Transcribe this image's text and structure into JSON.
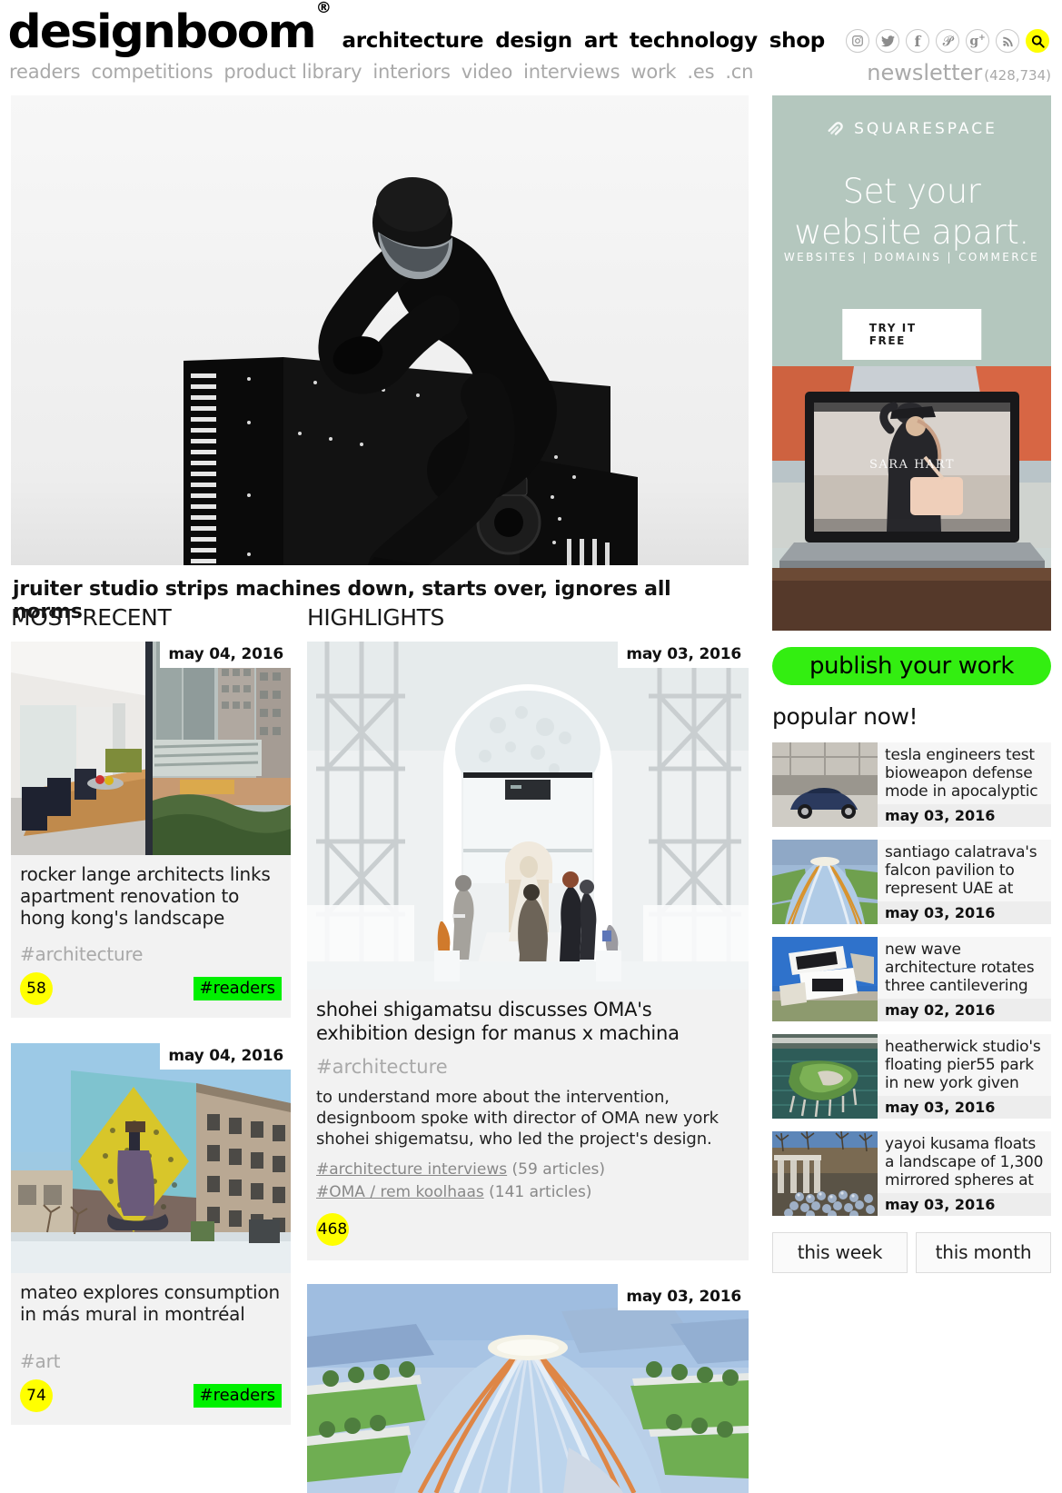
{
  "header": {
    "logo": "designboom",
    "logo_reg": "®",
    "primary_nav": [
      "architecture",
      "design",
      "art",
      "technology",
      "shop"
    ],
    "secondary_nav": [
      "readers",
      "competitions",
      "product library",
      "interiors",
      "video",
      "interviews",
      "work",
      ".es",
      ".cn"
    ],
    "social_icons": [
      "instagram-icon",
      "twitter-icon",
      "facebook-icon",
      "pinterest-icon",
      "googleplus-icon",
      "rss-icon",
      "search-icon"
    ],
    "newsletter_label": "newsletter",
    "newsletter_count": "(428,734)"
  },
  "hero": {
    "title": "jruiter studio strips machines down, starts over, ignores all norms",
    "image_alt": "rider in black suit and helmet on a matte black snowmobile"
  },
  "sections": {
    "most_recent": "MOST RECENT",
    "highlights": "HIGHLIGHTS"
  },
  "most_recent": [
    {
      "date": "may 04, 2016",
      "title": "rocker lange architects links apartment renovation to hong kong's landscape",
      "tag": "#architecture",
      "count": "58",
      "readers": "#readers",
      "image_alt": "white apartment interior with wooden table opening onto hong kong street view"
    },
    {
      "date": "may 04, 2016",
      "title": "mateo explores consumption in más mural in montréal",
      "tag": "#art",
      "count": "74",
      "readers": "#readers",
      "image_alt": "yellow diamond mural of seated figure on a brick building facade"
    }
  ],
  "highlights": [
    {
      "date": "may 03, 2016",
      "title": "shohei shigamatsu discusses OMA's exhibition design for manus x machina",
      "tag": "#architecture",
      "body": "to understand more about the intervention, designboom spoke with director of OMA new york shohei shigematsu, who led the project's design.",
      "links": [
        {
          "label": "#architecture interviews",
          "count": "(59 articles)"
        },
        {
          "label": "#OMA / rem koolhaas",
          "count": "(141 articles)"
        }
      ],
      "count": "468",
      "image_alt": "white arched exhibition hall with visitors viewing a gown on a plinth"
    },
    {
      "date": "may 03, 2016",
      "title": "",
      "image_alt": "blue fanned roof architectural rendering of a pavilion with landscaped plaza"
    }
  ],
  "ad": {
    "brand": "SQUARESPACE",
    "headline_line1": "Set your",
    "headline_line2": "website apart.",
    "subline": "WEBSITES  |  DOMAINS  |  COMMERCE",
    "cta": "TRY IT FREE",
    "photo_alt": "laptop on a wooden table showing a fashion website named SARA HART",
    "screen_brand": "SARA HART",
    "bg_color": "#b4c7be"
  },
  "publish_button": "publish your work",
  "popular": {
    "heading": "popular now!",
    "items": [
      {
        "title": "tesla engineers test bioweapon defense mode in apocalyptic",
        "date": "may 03, 2016",
        "image_alt": "dark blue tesla sedan inside an industrial factory"
      },
      {
        "title": "santiago calatrava's falcon pavilion to represent UAE at",
        "date": "may 03, 2016",
        "image_alt": "blue winged pavilion rendering surrounded by green lawns"
      },
      {
        "title": "new wave architecture rotates three cantilevering",
        "date": "may 02, 2016",
        "image_alt": "white angular cantilevered house against a blue sky"
      },
      {
        "title": "heatherwick studio's floating pier55 park in new york given",
        "date": "may 03, 2016",
        "image_alt": "green floating island park on pillars over a river"
      },
      {
        "title": "yayoi kusama floats a landscape of 1,300 mirrored spheres at",
        "date": "may 03, 2016",
        "image_alt": "mirrored silver spheres floating in a pond beside a colonnade"
      }
    ],
    "filters": [
      "this week",
      "this month"
    ]
  },
  "colors": {
    "yellow": "#ffff00",
    "green_readers": "#00f000",
    "green_publish": "#33ee11",
    "card_bg": "#f2f2f2",
    "muted_text": "#a9a9a9"
  }
}
